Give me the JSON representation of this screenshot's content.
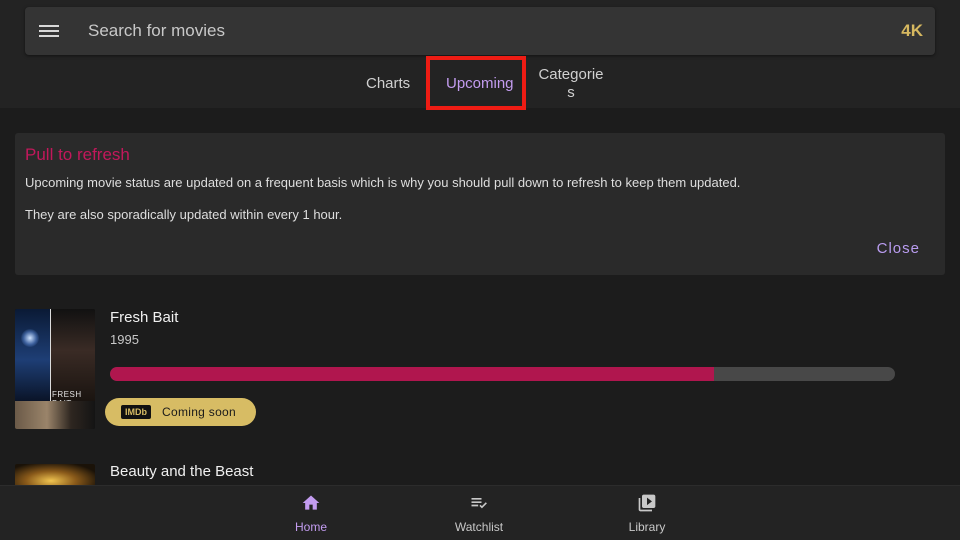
{
  "search": {
    "placeholder": "Search for movies",
    "badge": "4K"
  },
  "tabs": [
    {
      "label": "Charts",
      "active": false
    },
    {
      "label": "Upcoming",
      "active": true
    },
    {
      "label": "Categories",
      "active": false
    }
  ],
  "info_card": {
    "title": "Pull to refresh",
    "text1": "Upcoming movie status are updated on a frequent basis which is why you should pull down to refresh to keep them updated.",
    "text2": "They are also sporadically updated within every 1 hour.",
    "close_label": "Close"
  },
  "movies": [
    {
      "title": "Fresh Bait",
      "year": "1995",
      "poster_text": "FRESH BAIT",
      "progress": 0.77,
      "imdb_logo": "IMDb",
      "status": "Coming soon"
    },
    {
      "title": "Beauty and the Beast"
    }
  ],
  "bottom_nav": [
    {
      "label": "Home",
      "icon": "home-icon",
      "active": true
    },
    {
      "label": "Watchlist",
      "icon": "playlist-check-icon",
      "active": false
    },
    {
      "label": "Library",
      "icon": "video-library-icon",
      "active": false
    }
  ],
  "colors": {
    "accent": "#c39cf0",
    "pink": "#c2185b",
    "progress": "#b0164e",
    "gold": "#d7bc64",
    "highlight": "#ee1c14"
  }
}
